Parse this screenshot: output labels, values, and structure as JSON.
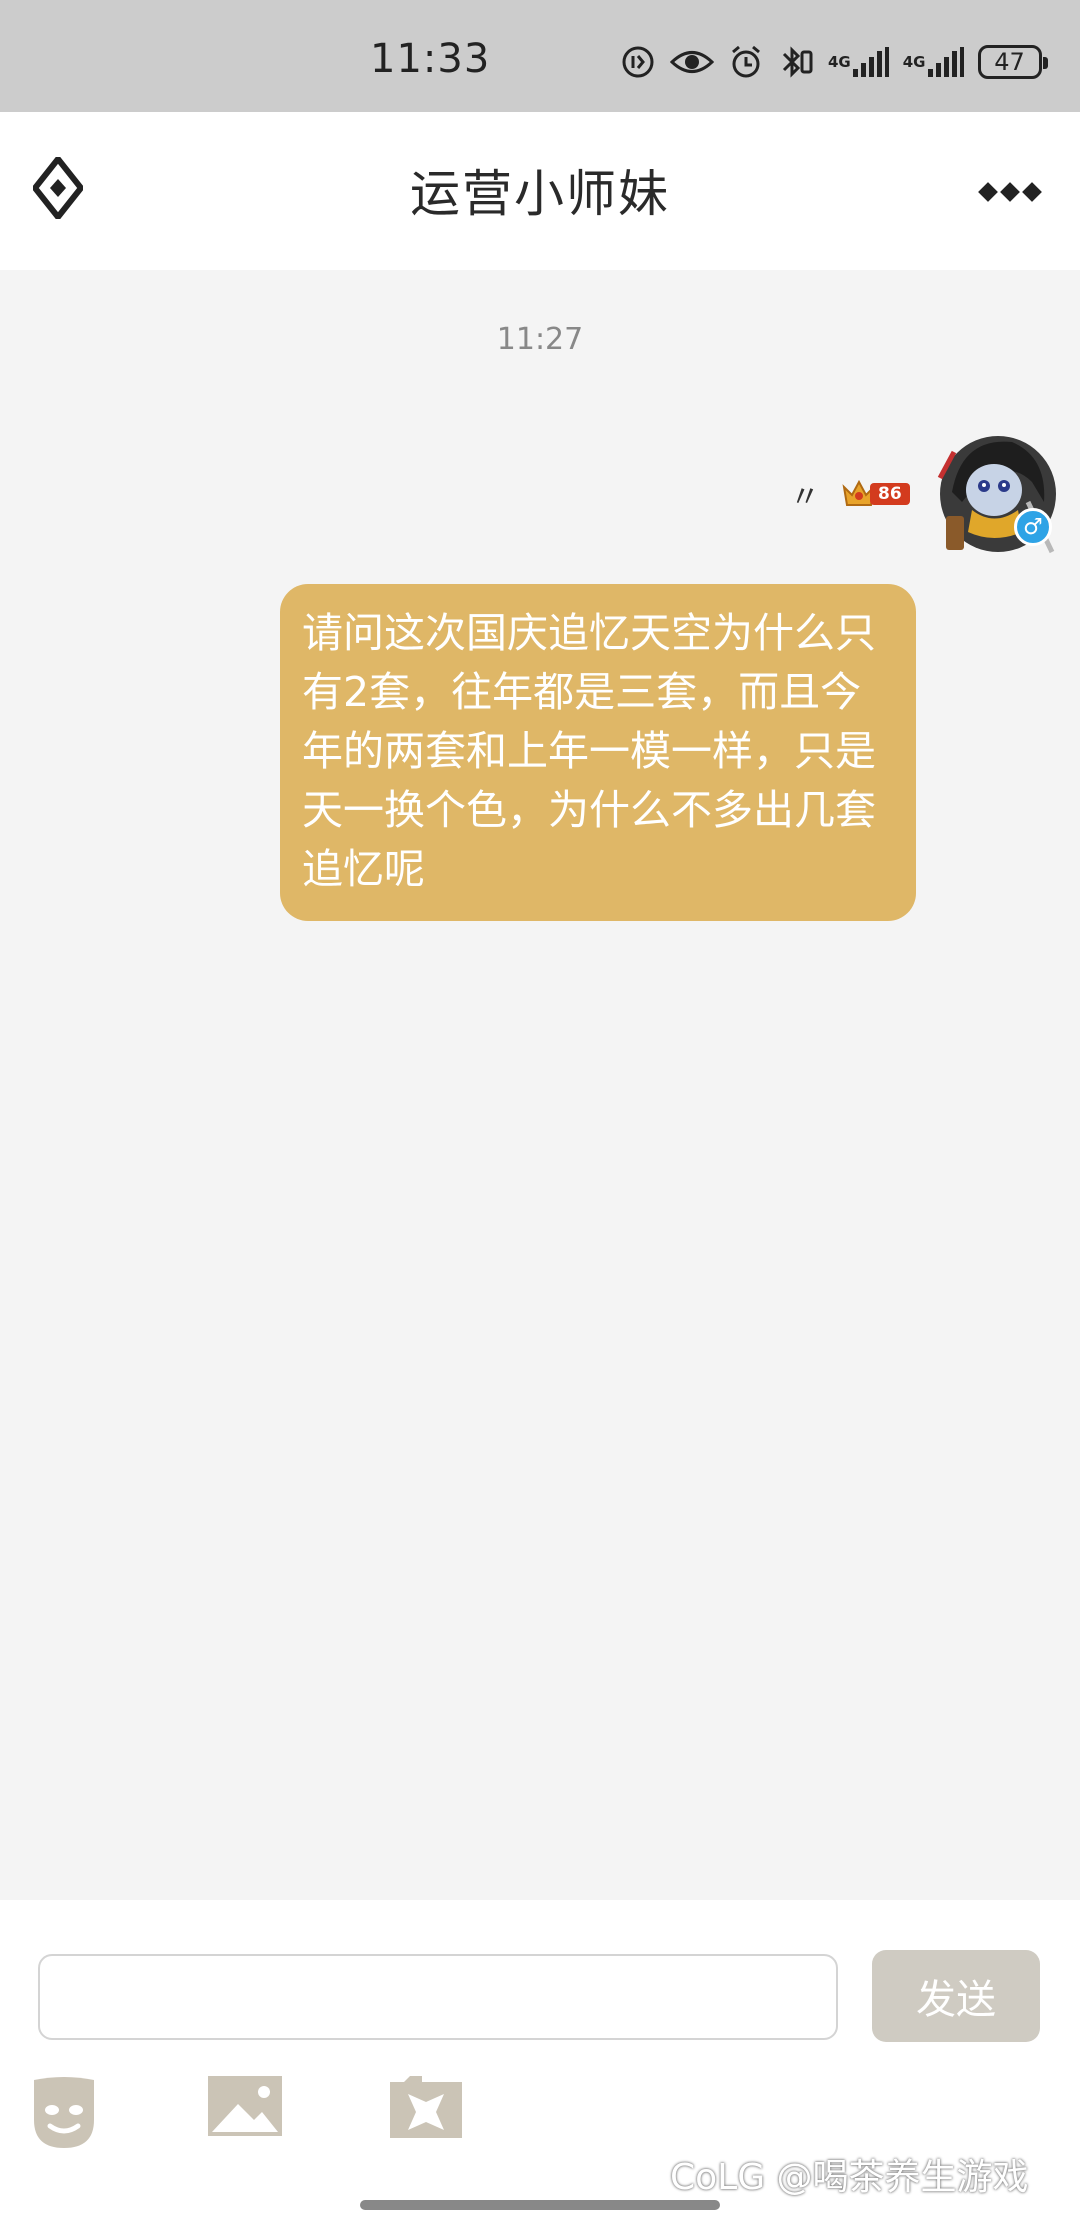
{
  "status_bar": {
    "time": "11:33",
    "network_1": "4G",
    "network_2": "4G",
    "battery": "47",
    "icons": [
      "data-saver-icon",
      "eye-icon",
      "alarm-icon",
      "bluetooth-icon",
      "signal-icon",
      "signal-icon",
      "battery-icon"
    ]
  },
  "header": {
    "title": "运营小师妹",
    "back_icon": "diamond-back-icon",
    "more_icon": "more-dots-icon"
  },
  "chat": {
    "timestamp": "11:27",
    "sender": {
      "nickname": "〃",
      "level": "86",
      "gender_symbol": "♂"
    },
    "message": "请问这次国庆追忆天空为什么只有2套，往年都是三套，而且今年的两套和上年一模一样，只是天一换个色，为什么不多出几套追忆呢"
  },
  "composer": {
    "input_value": "",
    "input_placeholder": "",
    "send_label": "发送",
    "tools": [
      "emoji-icon",
      "image-icon",
      "sticker-icon"
    ]
  },
  "watermark": "CoLG @喝茶养生游戏",
  "colors": {
    "bubble": "#dfb767",
    "send_button": "#cfcbc2",
    "status_bar": "#cccccc",
    "background": "#f4f4f4",
    "gender_badge": "#2ea3e6",
    "level_badge": "#d33b1e"
  }
}
